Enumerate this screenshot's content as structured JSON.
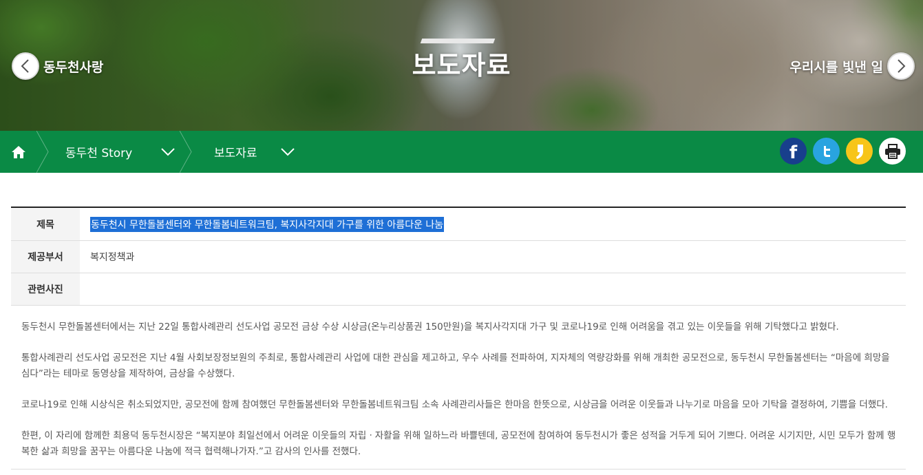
{
  "hero": {
    "title": "보도자료",
    "prev_label": "동두천사랑",
    "next_label": "우리시를 빛낸 일"
  },
  "breadcrumb": {
    "home_icon": "home-icon",
    "level1": "동두천 Story",
    "level2": "보도자료"
  },
  "social": {
    "facebook": "f",
    "colors": {
      "bar": "#0a8a45",
      "facebook": "#183f8c",
      "twitter": "#29a4e0",
      "kakaostory": "#f7c51a"
    }
  },
  "article": {
    "title_label": "제목",
    "title_value": "동두천시 무한돌봄센터와 무한돌봄네트워크팀, 복지사각지대 가구를 위한 아름다운 나눔",
    "dept_label": "제공부서",
    "dept_value": "복지정책과",
    "photo_label": "관련사진",
    "photo_value": "",
    "paragraphs": [
      "동두천시 무한돌봄센터에서는 지난 22일 통합사례관리 선도사업 공모전 금상 수상 시상금(온누리상품권 150만원)을 복지사각지대 가구 및 코로나19로 인해 어려움을 겪고 있는 이웃들을 위해 기탁했다고 밝혔다.",
      "통합사례관리 선도사업 공모전은 지난 4월 사회보장정보원의 주최로, 통합사례관리 사업에 대한 관심을 제고하고, 우수 사례를 전파하여, 지자체의 역량강화를 위해 개최한 공모전으로, 동두천시 무한돌봄센터는 “마음에 희망을 심다”라는 테마로 동영상을 제작하여, 금상을 수상했다.",
      "코로나19로 인해 시상식은 취소되었지만, 공모전에 함께 참여했던 무한돌봄센터와 무한돌봄네트워크팀 소속 사례관리사들은 한마음 한뜻으로, 시상금을 어려운 이웃들과 나누기로 마음을 모아 기탁을 결정하여, 기쁨을 더했다.",
      "한편, 이 자리에 함께한 최용덕 동두천시장은 “복지분야 최일선에서 어려운 이웃들의 자립ㆍ자활을 위해 일하느라 바쁠텐데, 공모전에 참여하여 동두천시가 좋은 성적을 거두게 되어 기쁘다. 어려운 시기지만, 시민 모두가 함께 행복한 삶과 희망을 꿈꾸는 아름다운 나눔에 적극 협력해나가자.”고 감사의 인사를 전했다."
    ]
  }
}
